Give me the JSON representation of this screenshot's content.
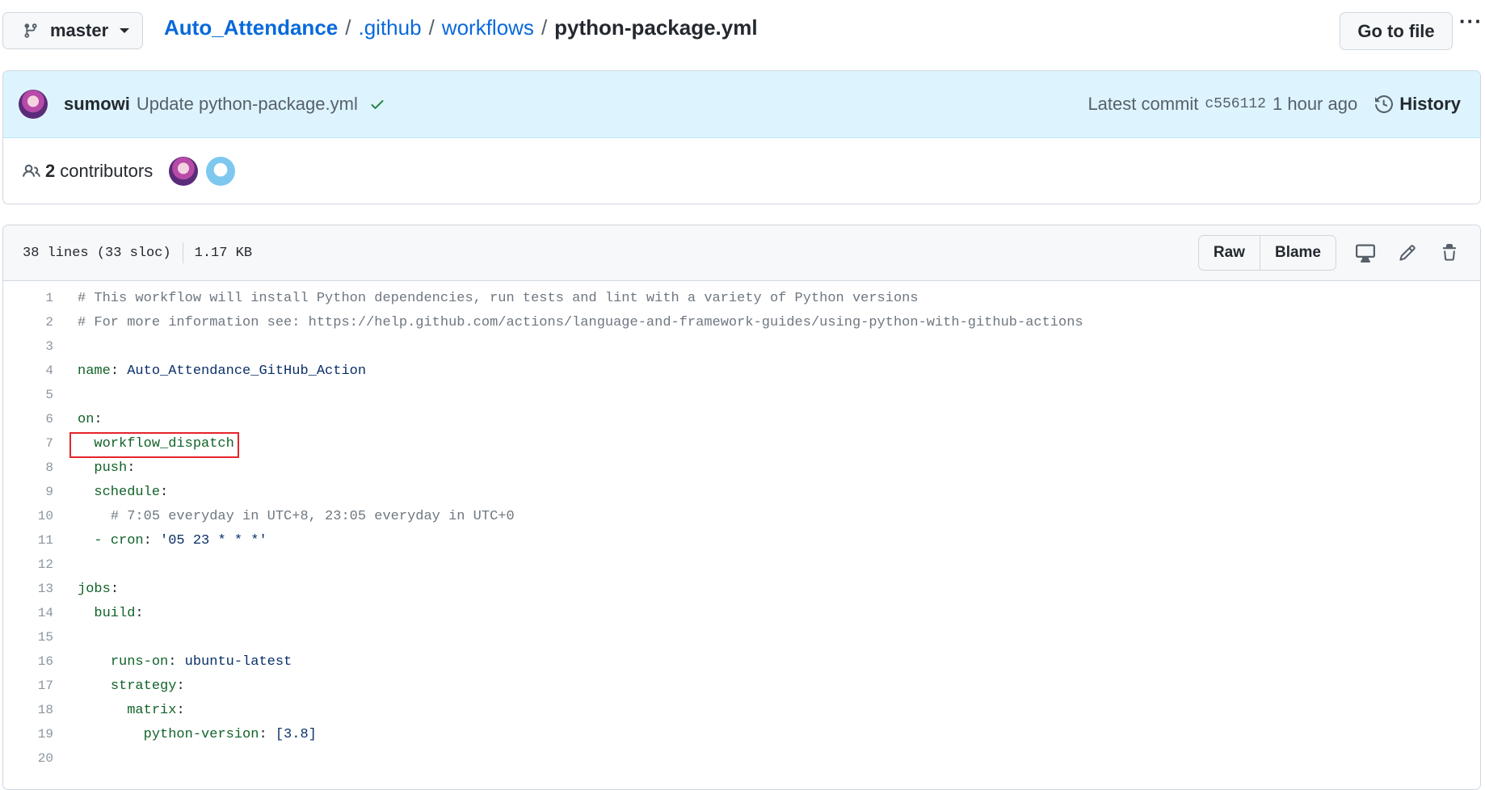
{
  "branch": {
    "name": "master"
  },
  "breadcrumb": {
    "repo": "Auto_Attendance",
    "folder1": ".github",
    "folder2": "workflows",
    "file": "python-package.yml",
    "sep": "/"
  },
  "actions": {
    "go_to_file": "Go to file",
    "more": "···"
  },
  "commit": {
    "author": "sumowi",
    "message": "Update python-package.yml",
    "latest_label": "Latest commit",
    "sha": "c556112",
    "time": "1 hour ago",
    "history_label": "History"
  },
  "contributors": {
    "count": "2",
    "label": "contributors"
  },
  "file": {
    "lines_info": "38 lines (33 sloc)",
    "size": "1.17 KB",
    "raw_label": "Raw",
    "blame_label": "Blame"
  },
  "code": {
    "l1": "# This workflow will install Python dependencies, run tests and lint with a variety of Python versions",
    "l2": "# For more information see: https://help.github.com/actions/language-and-framework-guides/using-python-with-github-actions",
    "l4_key": "name",
    "l4_val": "Auto_Attendance_GitHub_Action",
    "l6_key": "on",
    "l7_key": "workflow_dispatch",
    "l8_key": "push",
    "l9_key": "schedule",
    "l10": "# 7:05 everyday in UTC+8, 23:05 everyday in UTC+0",
    "l11_dash": "-",
    "l11_key": "cron",
    "l11_val": "'05 23 * * *'",
    "l13_key": "jobs",
    "l14_key": "build",
    "l16_key": "runs-on",
    "l16_val": "ubuntu-latest",
    "l17_key": "strategy",
    "l18_key": "matrix",
    "l19_key": "python-version",
    "l19_val": "[3.8]"
  },
  "colors": {
    "link": "#0969da",
    "highlight_border": "#e5242a",
    "yaml_key": "#116329",
    "comment": "#6e7781"
  },
  "icons": [
    "branch-icon",
    "check-icon",
    "history-icon",
    "people-icon",
    "display-icon",
    "pencil-icon",
    "trash-icon"
  ]
}
